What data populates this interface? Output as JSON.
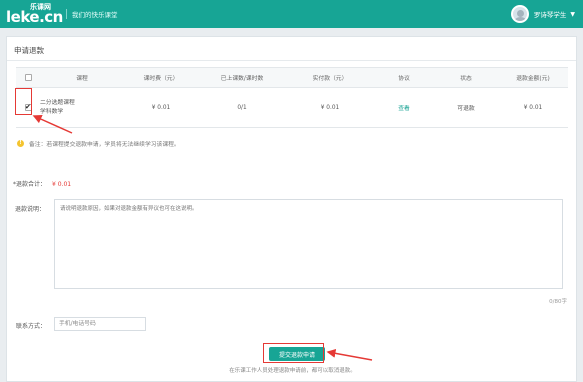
{
  "header": {
    "logo_top": "乐课网",
    "logo_main": "leke",
    "logo_suffix": ".cn",
    "slogan": "我们的快乐课堂",
    "username": "罗诗琴学生",
    "dropdown_icon": "caret-down-icon"
  },
  "panel": {
    "title": "申请退款"
  },
  "table": {
    "headers": [
      "课程",
      "课时费（元）",
      "已上课数/课时数",
      "实付款（元）",
      "协议",
      "状态",
      "退款金额(元)"
    ],
    "rows": [
      {
        "checked": true,
        "course_name": "二分选题课程",
        "course_sub": "学科数学",
        "fee": "¥ 0.01",
        "progress": "0/1",
        "paid": "¥ 0.01",
        "protocol": "查看",
        "status": "可退款",
        "refund": "¥ 0.01"
      }
    ]
  },
  "notice": {
    "icon": "warning-icon",
    "text": "备注：若课程提交退款申请，学员将无法继续学习该课程。"
  },
  "total": {
    "label": "*退款合计：",
    "amount": "¥ 0.01"
  },
  "reason": {
    "label": "退款说明：",
    "placeholder": "请说明退款原因，如果对退款金额有异议也可在这说明。",
    "counter": "0/80字"
  },
  "contact": {
    "label": "联系方式：",
    "placeholder": "手机/电话号码"
  },
  "submit": {
    "label": "提交退款申请",
    "note": "在乐课工作人员处理退款申请前，都可以取消退款。"
  },
  "colors": {
    "brand": "#17a595",
    "accent_red": "#e53935"
  }
}
